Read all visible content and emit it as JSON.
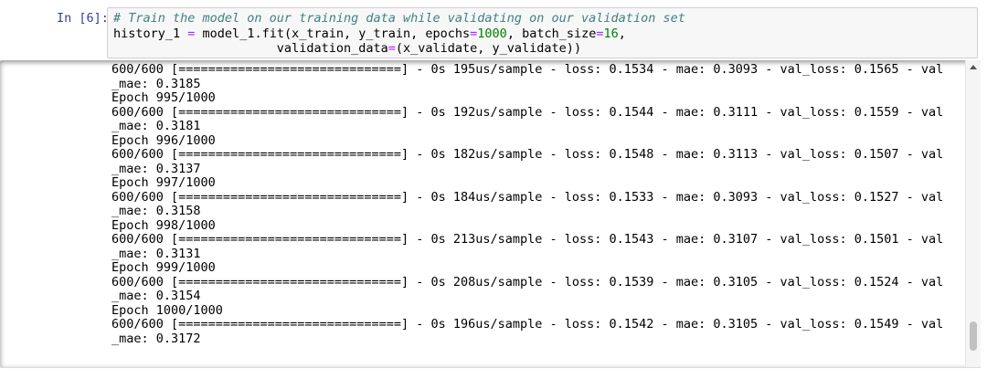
{
  "input": {
    "prompt": "In [6]:",
    "comment": "# Train the model on our training data while validating on our validation set",
    "line2_a": "history_1 ",
    "line2_eq": "=",
    "line2_b": " model_1.fit(x_train, y_train, epochs",
    "line2_eq2": "=",
    "line2_epochs": "1000",
    "line2_c": ", batch_size",
    "line2_eq3": "=",
    "line2_batch": "16",
    "line2_d": ",",
    "line3_a": "                      validation_data",
    "line3_eq": "=",
    "line3_b": "(x_validate, y_validate))"
  },
  "output": {
    "lines": [
      "600/600 [==============================] - 0s 195us/sample - loss: 0.1534 - mae: 0.3093 - val_loss: 0.1565 - val",
      "_mae: 0.3185",
      "Epoch 995/1000",
      "600/600 [==============================] - 0s 192us/sample - loss: 0.1544 - mae: 0.3111 - val_loss: 0.1559 - val",
      "_mae: 0.3181",
      "Epoch 996/1000",
      "600/600 [==============================] - 0s 182us/sample - loss: 0.1548 - mae: 0.3113 - val_loss: 0.1507 - val",
      "_mae: 0.3137",
      "Epoch 997/1000",
      "600/600 [==============================] - 0s 184us/sample - loss: 0.1533 - mae: 0.3093 - val_loss: 0.1527 - val",
      "_mae: 0.3158",
      "Epoch 998/1000",
      "600/600 [==============================] - 0s 213us/sample - loss: 0.1543 - mae: 0.3107 - val_loss: 0.1501 - val",
      "_mae: 0.3131",
      "Epoch 999/1000",
      "600/600 [==============================] - 0s 208us/sample - loss: 0.1539 - mae: 0.3105 - val_loss: 0.1524 - val",
      "_mae: 0.3154",
      "Epoch 1000/1000",
      "600/600 [==============================] - 0s 196us/sample - loss: 0.1542 - mae: 0.3105 - val_loss: 0.1549 - val",
      "_mae: 0.3172"
    ]
  },
  "colors": {
    "prompt": "#303f9f",
    "comment": "#408080",
    "number": "#008000",
    "operator": "#aa22ff",
    "input_bg": "#f7f7f7"
  },
  "icons": {
    "scroll_up": "scroll-up-arrow-icon"
  }
}
